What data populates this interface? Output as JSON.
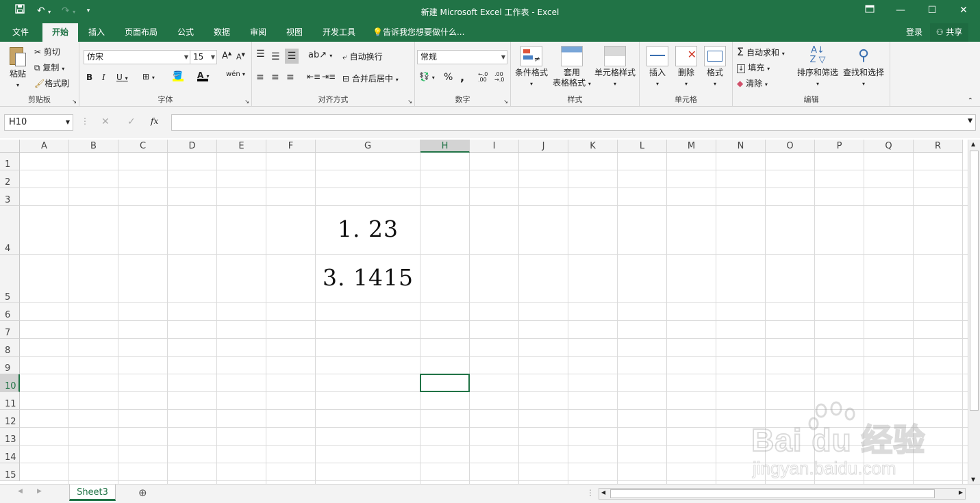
{
  "window": {
    "title": "新建 Microsoft Excel 工作表 - Excel",
    "login": "登录",
    "share": "共享"
  },
  "menu": {
    "tabs": [
      "文件",
      "开始",
      "插入",
      "页面布局",
      "公式",
      "数据",
      "审阅",
      "视图",
      "开发工具"
    ],
    "active": "开始",
    "tell_me": "告诉我您想要做什么..."
  },
  "ribbon": {
    "clipboard": {
      "label": "剪贴板",
      "paste": "粘贴",
      "cut": "剪切",
      "copy": "复制",
      "format_painter": "格式刷"
    },
    "font": {
      "label": "字体",
      "font_name": "仿宋",
      "font_size": "15",
      "bold": "B",
      "italic": "I",
      "underline": "U",
      "grow": "A",
      "shrink": "A",
      "wen": "wén",
      "color_a": "A"
    },
    "alignment": {
      "label": "对齐方式",
      "wrap": "自动换行",
      "merge": "合并后居中"
    },
    "number": {
      "label": "数字",
      "format": "常规",
      "percent": "%",
      "comma": ",",
      "inc": "←.0\n.00",
      "dec": ".00\n→.0"
    },
    "styles": {
      "label": "样式",
      "conditional": "条件格式",
      "table_l1": "套用",
      "table_l2": "表格格式",
      "cell_styles": "单元格样式"
    },
    "cells": {
      "label": "单元格",
      "insert": "插入",
      "delete": "删除",
      "format": "格式"
    },
    "editing": {
      "label": "编辑",
      "autosum": "自动求和",
      "fill": "填充",
      "clear": "清除",
      "sort": "排序和筛选",
      "find": "查找和选择"
    }
  },
  "formula_bar": {
    "name_box": "H10",
    "fx": "fx",
    "formula": ""
  },
  "grid": {
    "columns": [
      "A",
      "B",
      "C",
      "D",
      "E",
      "F",
      "G",
      "H",
      "I",
      "J",
      "K",
      "L",
      "M",
      "N",
      "O",
      "P",
      "Q",
      "R"
    ],
    "rows": [
      "1",
      "2",
      "3",
      "4",
      "5",
      "6",
      "7",
      "8",
      "9",
      "10",
      "11",
      "12",
      "13",
      "14",
      "15"
    ],
    "selected_column": "H",
    "selected_row": "10",
    "cells": {
      "G4": "1. 23",
      "G5": "3. 1415"
    }
  },
  "sheets": {
    "tabs": [
      "Sheet3"
    ],
    "active": "Sheet3"
  },
  "watermark": {
    "brand": "Bai du 经验",
    "url": "jingyan.baidu.com"
  }
}
